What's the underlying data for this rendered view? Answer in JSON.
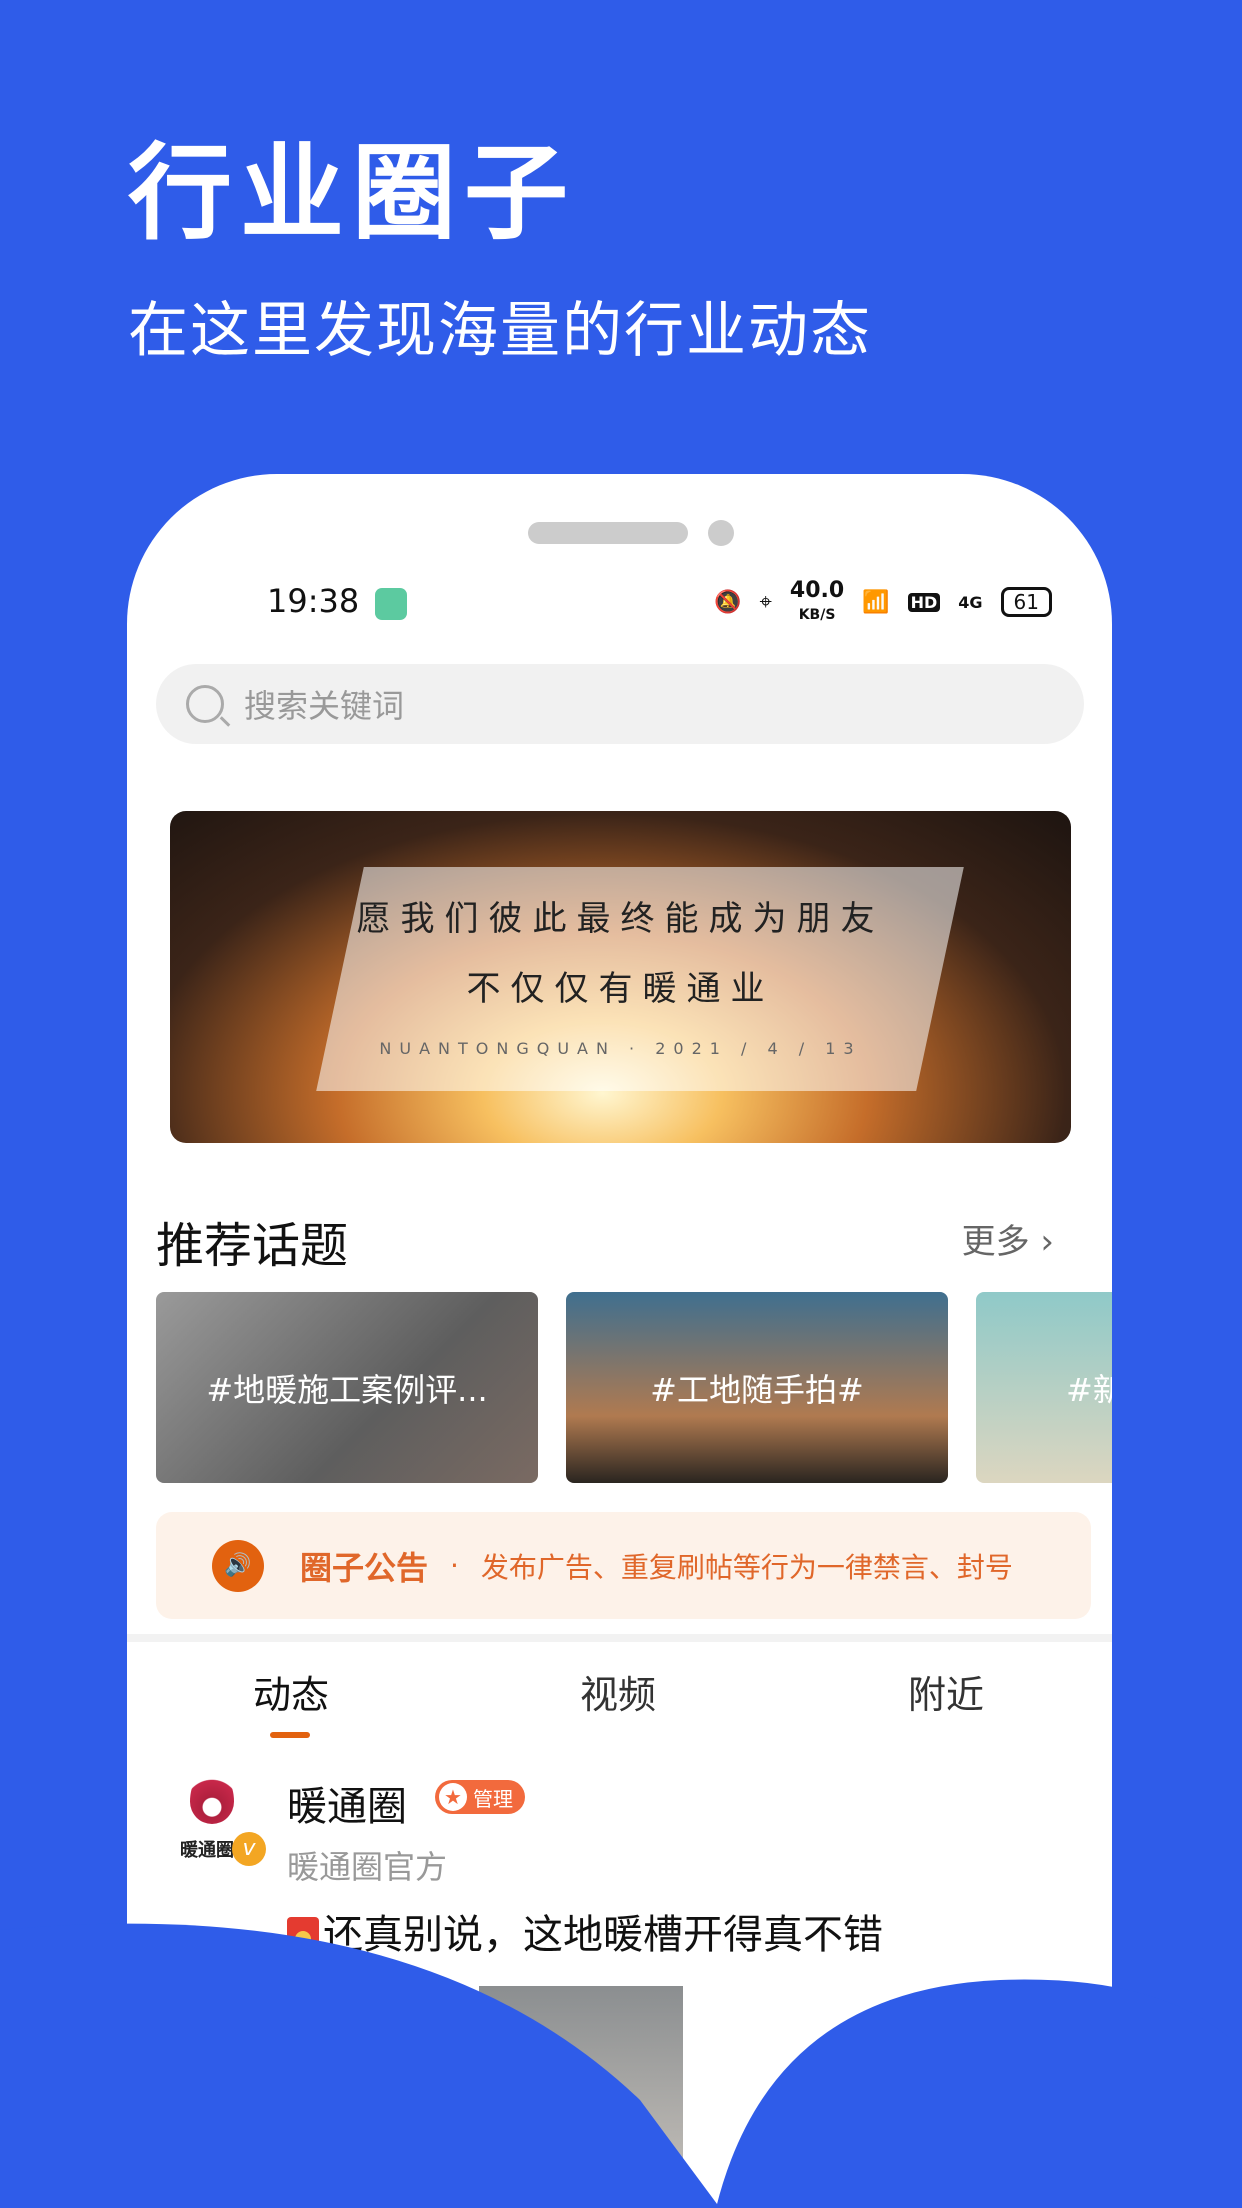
{
  "header": {
    "title": "行业圈子",
    "subtitle": "在这里发现海量的行业动态"
  },
  "colors": {
    "background": "#2f5ce9",
    "accent": "#e2620f",
    "notice_bg": "#fdf2e9"
  },
  "status_bar": {
    "time": "19:38",
    "speed": "40.0",
    "speed_unit": "KB/S",
    "network": "4G",
    "hd": "HD",
    "battery": "61"
  },
  "search": {
    "placeholder": "搜索关键词"
  },
  "banner": {
    "line1": "愿我们彼此最终能成为朋友",
    "line2": "不仅仅有暖通业",
    "caption": "NUANTONGQUAN · 2021 / 4 / 13"
  },
  "topics": {
    "title": "推荐话题",
    "more": "更多",
    "items": [
      {
        "label": "#地暖施工案例评..."
      },
      {
        "label": "#工地随手拍#"
      },
      {
        "label": "#新"
      }
    ]
  },
  "notice": {
    "title": "圈子公告",
    "text": "发布广告、重复刷帖等行为一律禁言、封号"
  },
  "tabs": [
    {
      "label": "动态",
      "active": true
    },
    {
      "label": "视频"
    },
    {
      "label": "附近"
    }
  ],
  "post": {
    "author": "暖通圈",
    "badge": "管理",
    "subtitle": "暖通圈官方",
    "body": "还真别说，这地暖槽开得真不错",
    "avatar_text": "暖通圈",
    "verified": "v"
  }
}
